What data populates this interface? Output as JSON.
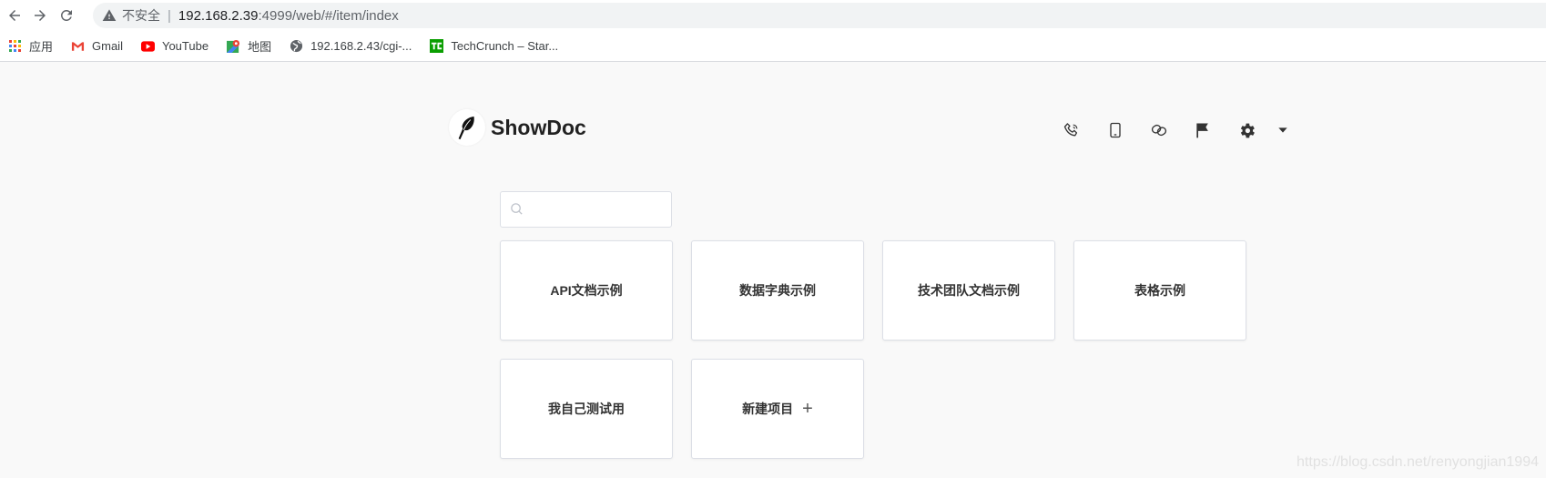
{
  "browser": {
    "security_label": "不安全",
    "url_host": "192.168.2.39",
    "url_rest": ":4999/web/#/item/index",
    "bookmarks": [
      {
        "label": "应用",
        "icon": "apps-grid-icon"
      },
      {
        "label": "Gmail",
        "icon": "gmail-icon"
      },
      {
        "label": "YouTube",
        "icon": "youtube-icon"
      },
      {
        "label": "地图",
        "icon": "maps-icon"
      },
      {
        "label": "192.168.2.43/cgi-...",
        "icon": "globe-icon"
      },
      {
        "label": "TechCrunch – Star...",
        "icon": "techcrunch-icon"
      }
    ]
  },
  "app": {
    "logo_text": "ShowDoc",
    "header_icons": [
      "phone-icon",
      "mobile-icon",
      "link-icon",
      "flag-icon",
      "gear-icon",
      "caret-down-icon"
    ]
  },
  "search": {
    "value": "",
    "placeholder": ""
  },
  "projects": [
    {
      "label": "API文档示例"
    },
    {
      "label": "数据字典示例"
    },
    {
      "label": "技术团队文档示例"
    },
    {
      "label": "表格示例"
    },
    {
      "label": "我自己测试用"
    }
  ],
  "new_project": {
    "label": "新建项目",
    "plus": "+"
  },
  "watermark": "https://blog.csdn.net/renyongjian1994",
  "colors": {
    "page_bg": "#f9f9f9",
    "card_border": "#dcdfe6",
    "text_dark": "#333333"
  }
}
